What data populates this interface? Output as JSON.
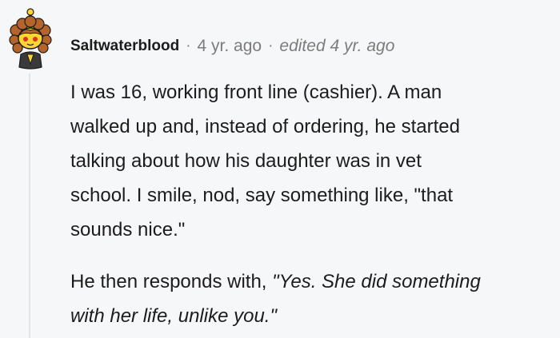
{
  "comment": {
    "author": "Saltwaterblood",
    "separator": "·",
    "age": "4 yr. ago",
    "edited": "edited 4 yr. ago",
    "paragraph1_lines": [
      "I was 16, working front line (cashier). A man",
      "walked up and, instead of ordering, he started",
      "talking about how his daughter was in vet",
      "school. I smile, nod, say something like, \"that",
      "sounds nice.\""
    ],
    "paragraph2_prefix": "He then responds with, ",
    "paragraph2_quote_line1": "\"Yes. She did something",
    "paragraph2_quote_line2": "with her life, unlike you.\""
  },
  "colors": {
    "background": "#f6f7f8",
    "text": "#1c1c1c",
    "meta_text": "#7c7c7c",
    "thread_line": "#e3e5e8"
  },
  "icons": {
    "avatar": "snoo-avatar-icon"
  }
}
